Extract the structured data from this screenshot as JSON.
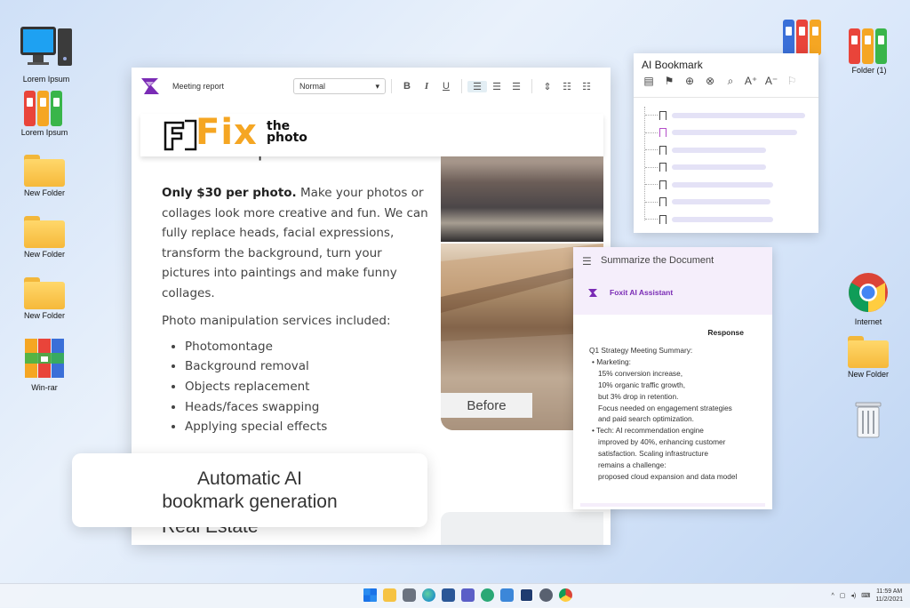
{
  "desktop": {
    "icons_left": [
      {
        "label": "Lorem Ipsum",
        "kind": "computer-icon"
      },
      {
        "label": "Lorem Ipsum",
        "kind": "binders-icon"
      },
      {
        "label": "New Folder",
        "kind": "folder-icon"
      },
      {
        "label": "New Folder",
        "kind": "folder-icon"
      },
      {
        "label": "New Folder",
        "kind": "folder-icon"
      },
      {
        "label": "Win-rar",
        "kind": "winrar-icon"
      }
    ],
    "icons_right": [
      {
        "label": "",
        "kind": "binders-icon"
      },
      {
        "label": "Folder (1)",
        "kind": "binders-icon"
      },
      {
        "label": "Internet",
        "kind": "chrome-icon"
      },
      {
        "label": "New Folder",
        "kind": "folder-icon"
      },
      {
        "label": "",
        "kind": "recycle-bin-icon"
      }
    ]
  },
  "editor": {
    "doc_name": "Meeting report",
    "style_value": "Normal",
    "toolbar": {
      "bold": "B",
      "italic": "I",
      "underline": "U"
    },
    "banner": {
      "fix": "Fix",
      "the": "the",
      "photo": "photo"
    },
    "heading_partial": "Photo Manipulation",
    "intro_bold": "Only $30 per photo.",
    "intro_rest": " Make your photos or collages look more creative and fun. We can fully replace heads, facial expressions, transform the background, turn your pictures into paintings and make funny collages.",
    "services_intro": "Photo manipulation services included:",
    "services": [
      "Photomontage",
      "Background removal",
      "Objects replacement",
      "Heads/faces swapping",
      "Applying special effects"
    ],
    "before_label": "Before",
    "next_heading": "Real Estate"
  },
  "caption": {
    "line1": "Automatic AI",
    "line2": "bookmark generation"
  },
  "bookmark_panel": {
    "title": "AI Bookmark",
    "tools": [
      "list-icon",
      "bookmark-icon",
      "add-bookmark-icon",
      "delete-bookmark-icon",
      "search-bookmark-icon",
      "font-increase-icon",
      "font-decrease-icon",
      "ai-bookmark-icon"
    ],
    "items": [
      {
        "active": false,
        "fill": 0.85
      },
      {
        "active": true,
        "fill": 0.8
      },
      {
        "active": false,
        "fill": 0.6
      },
      {
        "active": false,
        "fill": 0.6
      },
      {
        "active": false,
        "fill": 0.65
      },
      {
        "active": false,
        "fill": 0.63
      },
      {
        "active": false,
        "fill": 0.65
      }
    ],
    "accent": "#b44ec9"
  },
  "ai_panel": {
    "title": "Summarize the Document",
    "assistant": "Foxit AI Assistant",
    "response_label": "Response",
    "response_lines": [
      {
        "t": "Q1 Strategy Meeting Summary:",
        "indent": 0
      },
      {
        "t": "• Marketing:",
        "indent": 1
      },
      {
        "t": "15% conversion increase,",
        "indent": 2
      },
      {
        "t": "10% organic traffic growth,",
        "indent": 2
      },
      {
        "t": "but 3% drop in retention.",
        "indent": 2
      },
      {
        "t": "Focus needed on engagement strategies",
        "indent": 2
      },
      {
        "t": "and paid search optimization.",
        "indent": 2
      },
      {
        "t": "• Tech: AI recommendation engine",
        "indent": 1
      },
      {
        "t": "improved by 40%, enhancing customer",
        "indent": 2
      },
      {
        "t": "satisfaction. Scaling infrastructure",
        "indent": 2
      },
      {
        "t": "remains a challenge:",
        "indent": 2
      },
      {
        "t": "proposed cloud expansion and data model",
        "indent": 2
      }
    ]
  },
  "taskbar": {
    "time": "11:59 AM",
    "date": "11/2/2021",
    "tray_caret": "^"
  }
}
